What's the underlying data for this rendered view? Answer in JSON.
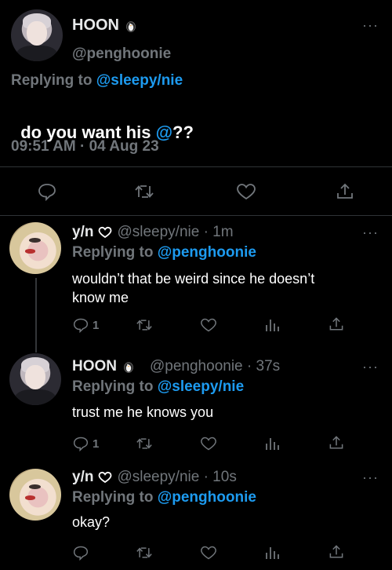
{
  "main": {
    "name": "HOON",
    "handle": "@penghoonie",
    "replying_prefix": "Replying to ",
    "replying_handle": "@sleepy/nie",
    "text_before": "do you want his ",
    "text_mention": "@",
    "text_after": "??",
    "timestamp": "09:51 AM · 04 Aug 23"
  },
  "replies": [
    {
      "name": "y/n",
      "handle": "@sleepy/nie · 1m",
      "replying_prefix": "Replying to ",
      "replying_handle": "@penghoonie",
      "text_line1": "wouldn’t that be weird since he doesn’t",
      "text_line2": "know me",
      "reply_count": "1"
    },
    {
      "name": "HOON",
      "handle": "@penghoonie · 37s",
      "replying_prefix": "Replying to ",
      "replying_handle": "@sleepy/nie",
      "text_line1": "trust me he knows you",
      "reply_count": "1"
    },
    {
      "name": "y/n",
      "handle": "@sleepy/nie · 10s",
      "replying_prefix": "Replying to ",
      "replying_handle": "@penghoonie",
      "text_line1": "okay?"
    }
  ],
  "icons": {
    "more": "more-dots-icon",
    "reply": "reply-bubble-icon",
    "retweet": "retweet-icon",
    "like": "heart-icon",
    "share": "share-icon",
    "views": "views-chart-icon",
    "penguin": "penguin-emoji-icon",
    "heart_badge": "white-heart-emoji-icon"
  },
  "colors": {
    "background": "#000000",
    "text": "#e7e9ea",
    "muted": "#71767b",
    "accent": "#1d9bf0",
    "divider": "#2f3336"
  }
}
